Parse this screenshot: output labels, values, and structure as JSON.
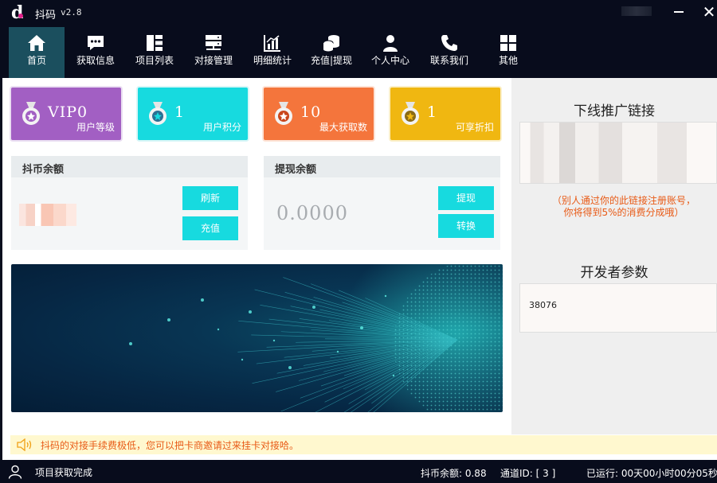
{
  "titlebar": {
    "app_name": "抖码",
    "version": "v2.8",
    "close_glyph": "✕"
  },
  "nav": [
    {
      "label": "首页",
      "icon": "home-icon"
    },
    {
      "label": "获取信息",
      "icon": "message-icon"
    },
    {
      "label": "项目列表",
      "icon": "list-icon"
    },
    {
      "label": "对接管理",
      "icon": "server-icon"
    },
    {
      "label": "明细统计",
      "icon": "chart-icon"
    },
    {
      "label": "充值|提现",
      "icon": "coins-icon"
    },
    {
      "label": "个人中心",
      "icon": "user-icon"
    },
    {
      "label": "联系我们",
      "icon": "phone-icon"
    },
    {
      "label": "其他",
      "icon": "apps-icon"
    }
  ],
  "cards": {
    "vip": {
      "value": "VIP0",
      "label": "用户等级",
      "color": "#a25fc3"
    },
    "points": {
      "value": "1",
      "label": "用户积分",
      "color": "#17dadf"
    },
    "max": {
      "value": "10",
      "label": "最大获取数",
      "color": "#f4753c"
    },
    "discount": {
      "value": "1",
      "label": "可享折扣",
      "color": "#f0b711"
    }
  },
  "coin_panel": {
    "title": "抖币余额",
    "refresh_label": "刷新",
    "recharge_label": "充值"
  },
  "withdraw_panel": {
    "title": "提现余额",
    "value": "0.0000",
    "withdraw_label": "提现",
    "convert_label": "转换"
  },
  "side": {
    "link_title": "下线推广链接",
    "link_note_1": "（别人通过你的此链接注册账号，",
    "link_note_2": "你将得到5%的消费分成哦）",
    "dev_title": "开发者参数",
    "dev_value": "38076"
  },
  "notice": {
    "text": "抖码的对接手续费极低，您可以把卡商邀请过来挂卡对接哈。"
  },
  "status": {
    "message": "项目获取完成",
    "balance": "抖币余额: 0.88",
    "channel": "通道ID: [ 3 ]",
    "uptime": "已运行: 00天00小时00分05秒"
  },
  "colors": {
    "accent": "#17dadf",
    "nav_bg": "#080c1c",
    "active_tab": "#1b4f5e",
    "note": "#e85a16"
  }
}
